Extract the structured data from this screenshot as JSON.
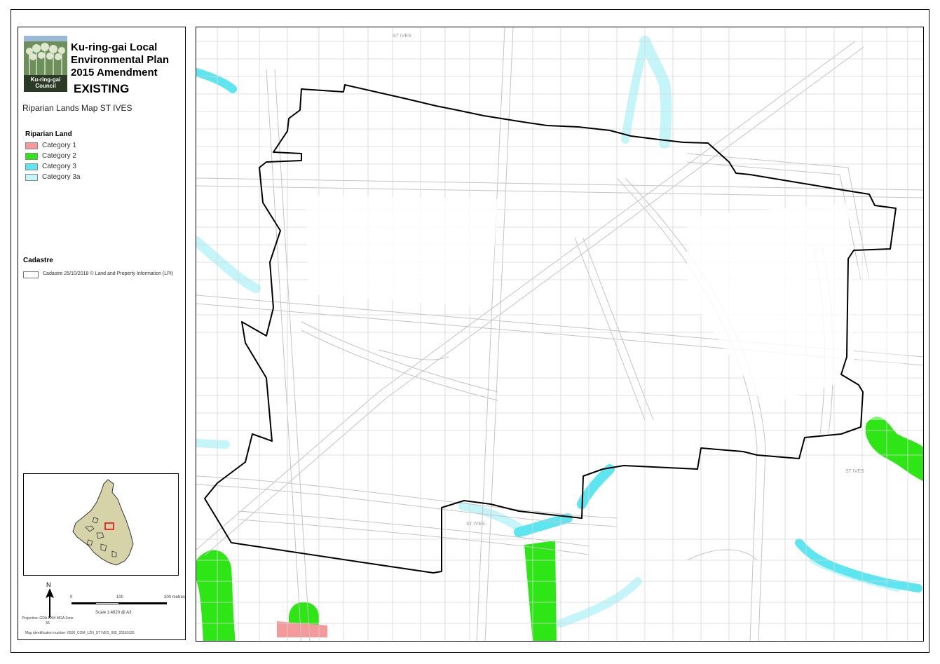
{
  "header": {
    "title_line1": "Ku-ring-gai Local",
    "title_line2": "Environmental Plan",
    "title_line3": "2015 Amendment",
    "status": "EXISTING",
    "map_title": "Riparian Lands Map ST IVES",
    "logo_line1": "Ku-ring-gai",
    "logo_line2": "Council"
  },
  "legend": {
    "riparian_heading": "Riparian Land",
    "categories": [
      {
        "label": "Category 1",
        "color": "#f49a9a"
      },
      {
        "label": "Category 2",
        "color": "#2ee616"
      },
      {
        "label": "Category 3",
        "color": "#5ee6f0"
      },
      {
        "label": "Category 3a",
        "color": "#c4f5f8"
      }
    ],
    "cadastre_heading": "Cadastre",
    "cadastre_label": "Cadastre 25/10/2018 © Land and Property Information (LPI)"
  },
  "scale": {
    "tick_0": "0",
    "tick_100": "100",
    "tick_200": "200 metres",
    "caption": "Scale  1:4620   @ A3",
    "north_label": "N",
    "projection": "Projection: GDA 1994 MGA Zone 56"
  },
  "map_id": "Map identification number:  6500_COM_LZN_ST IVES_005_20181026",
  "map": {
    "street_labels": [
      "ST IVES",
      "ST IVES",
      "ST IVES"
    ],
    "boundary_color": "#000000",
    "cadastre_color": "#bbbbbb"
  }
}
